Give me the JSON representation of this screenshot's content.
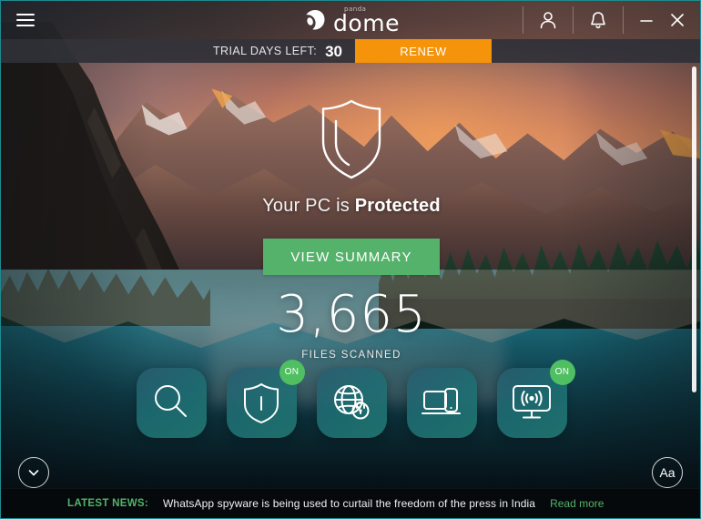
{
  "window": {
    "menu_icon": "hamburger-icon",
    "logo_brand": "panda",
    "logo_word": "dome",
    "account_icon": "user-icon",
    "notifications_icon": "bell-icon",
    "minimize_label": "–",
    "close_label": "✕"
  },
  "trial": {
    "label": "TRIAL DAYS LEFT:",
    "days": "30",
    "renew_label": "RENEW",
    "renew_color": "#f5930a"
  },
  "status": {
    "shield_icon": "shield-outline-icon",
    "prefix": "Your PC is ",
    "state": "Protected",
    "summary_button": "VIEW SUMMARY",
    "summary_button_color": "#55b26b",
    "files_scanned": "3,665",
    "files_scanned_label": "FILES SCANNED"
  },
  "dock": {
    "items": [
      {
        "name": "scan",
        "icon": "magnifier-icon",
        "badge": null
      },
      {
        "name": "antivirus",
        "icon": "shield-icon",
        "badge": "ON"
      },
      {
        "name": "vpn",
        "icon": "globe-lock-icon",
        "badge": null
      },
      {
        "name": "my-devices",
        "icon": "devices-icon",
        "badge": null
      },
      {
        "name": "wifi-protection",
        "icon": "wifi-monitor-icon",
        "badge": "ON"
      }
    ],
    "badge_color": "#4fbf62"
  },
  "corner_buttons": {
    "collapse_icon": "chevron-down-icon",
    "text_size_label": "Aa"
  },
  "news": {
    "label": "LATEST NEWS:",
    "headline": "WhatsApp spyware is being used to curtail the freedom of the press in India",
    "link": "Read more",
    "accent_color": "#55b26b"
  }
}
